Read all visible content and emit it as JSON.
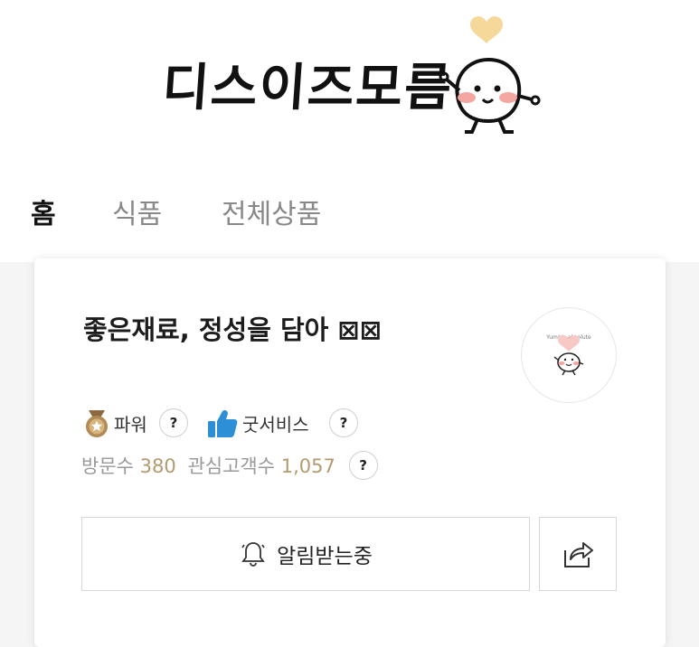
{
  "header": {
    "logo_text": "디스이즈모름"
  },
  "tabs": [
    {
      "label": "홈",
      "active": true
    },
    {
      "label": "식품",
      "active": false
    },
    {
      "label": "전체상품",
      "active": false
    }
  ],
  "store": {
    "title": "좋은재료, 정성을 담아 ⊠⊠",
    "profile_caption": "Yum! is absolute"
  },
  "badges": {
    "power": {
      "label": "파워",
      "icon": "medal-icon",
      "help": "?"
    },
    "goodservice": {
      "label": "굿서비스",
      "icon": "thumbs-up-icon",
      "help": "?"
    }
  },
  "stats": {
    "visits_label": "방문수",
    "visits_value": "380",
    "followers_label": "관심고객수",
    "followers_value": "1,057",
    "help": "?"
  },
  "buttons": {
    "notify_label": "알림받는중",
    "notify_icon": "bell-icon",
    "share_icon": "share-icon"
  },
  "colors": {
    "accent_gold": "#b39a6e",
    "thumb_blue": "#2d8fd5",
    "medal_bronze": "#b28a55",
    "heart": "#f5d89a",
    "cheek": "#f4a6a0"
  }
}
